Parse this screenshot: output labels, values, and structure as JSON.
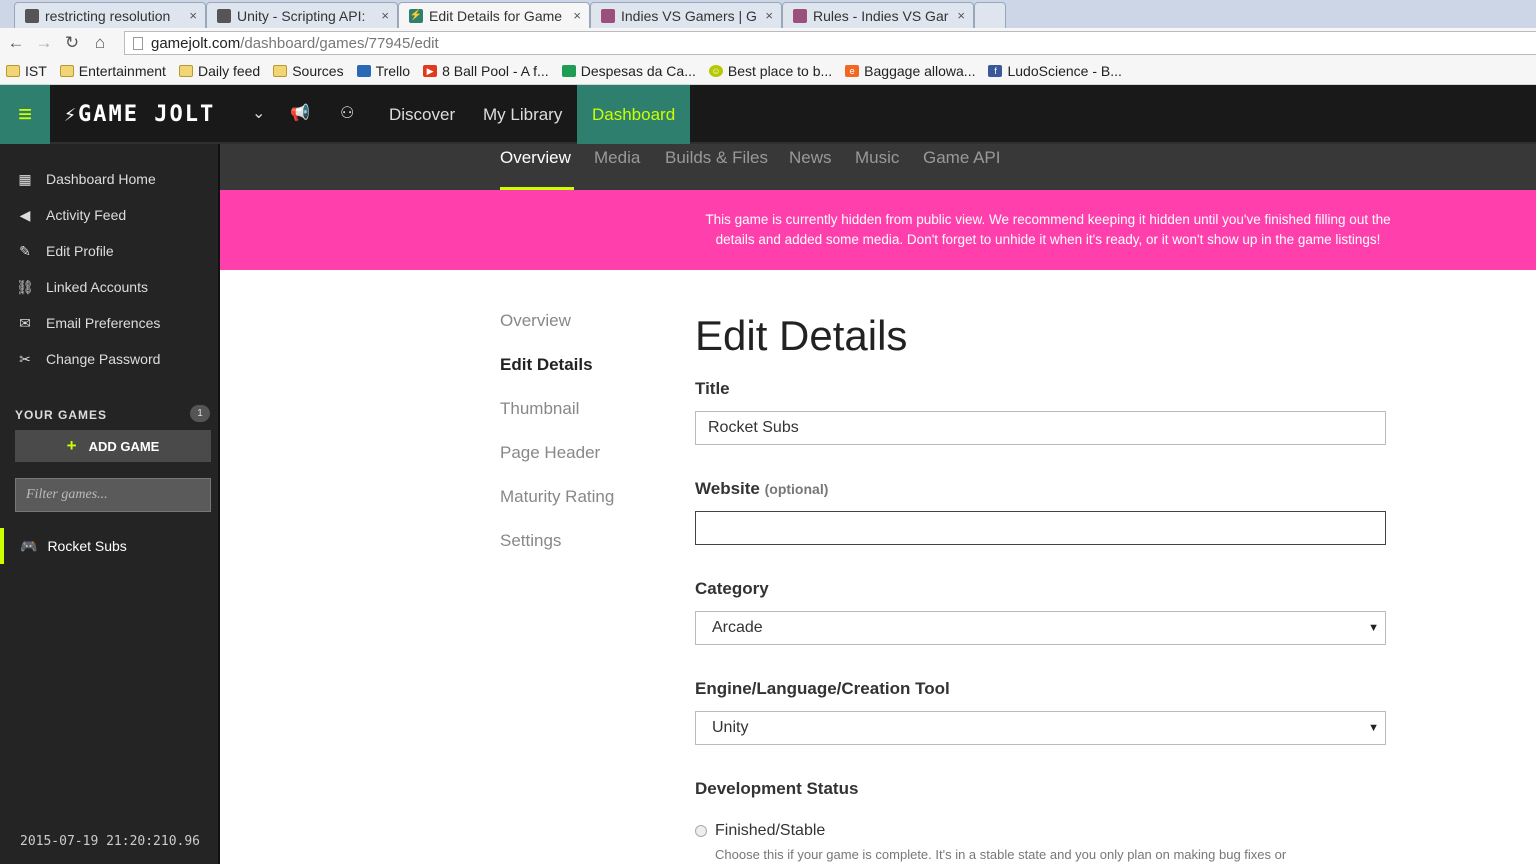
{
  "browser": {
    "tabs": [
      {
        "label": "restricting resolution",
        "favicon_color": "#555555",
        "active": false
      },
      {
        "label": "Unity - Scripting API:",
        "favicon_color": "#555555",
        "active": false
      },
      {
        "label": "Edit Details for Game",
        "favicon_color": "#2f7f6f",
        "active": true
      },
      {
        "label": "Indies VS Gamers | G",
        "favicon_color": "#9b4f7a",
        "active": false
      },
      {
        "label": "Rules - Indies VS Gar",
        "favicon_color": "#9b4f7a",
        "active": false
      }
    ],
    "close_glyph": "×",
    "url_host": "gamejolt.com",
    "url_path": "/dashboard/games/77945/edit",
    "nav_glyphs": {
      "back": "←",
      "forward": "→",
      "reload": "↻",
      "home": "⌂"
    },
    "bookmarks": [
      {
        "label": "IST",
        "icon": "folder-icon",
        "color": "#f2d675"
      },
      {
        "label": "Entertainment",
        "icon": "folder-icon",
        "color": "#f2d675"
      },
      {
        "label": "Daily feed",
        "icon": "folder-icon",
        "color": "#f2d675"
      },
      {
        "label": "Sources",
        "icon": "folder-icon",
        "color": "#f2d675"
      },
      {
        "label": "Trello",
        "icon": "trello-icon",
        "color": "#2a6ab5"
      },
      {
        "label": "8 Ball Pool - A f...",
        "icon": "play-icon",
        "color": "#e03a1e"
      },
      {
        "label": "Despesas da Ca...",
        "icon": "sheet-icon",
        "color": "#1f9d55"
      },
      {
        "label": "Best place to b...",
        "icon": "smiley-icon",
        "color": "#b5c800"
      },
      {
        "label": "Baggage allowa...",
        "icon": "e-icon",
        "color": "#f26722"
      },
      {
        "label": "LudoScience - B...",
        "icon": "facebook-icon",
        "color": "#3b5998"
      }
    ]
  },
  "header": {
    "logo_text": "GAME JOLT",
    "nav": [
      {
        "label": "Discover",
        "active": false
      },
      {
        "label": "My Library",
        "active": false
      },
      {
        "label": "Dashboard",
        "active": true
      }
    ],
    "colors": {
      "accent": "#ccff00",
      "teal": "#2f7f6f"
    }
  },
  "sidebar": {
    "items": [
      {
        "label": "Dashboard Home",
        "icon": "dashboard-icon",
        "glyph": "▦"
      },
      {
        "label": "Activity Feed",
        "icon": "megaphone-icon",
        "glyph": "📢"
      },
      {
        "label": "Edit Profile",
        "icon": "pencil-icon",
        "glyph": "✎"
      },
      {
        "label": "Linked Accounts",
        "icon": "link-icon",
        "glyph": "🔗"
      },
      {
        "label": "Email Preferences",
        "icon": "envelope-icon",
        "glyph": "✉"
      },
      {
        "label": "Change Password",
        "icon": "tools-icon",
        "glyph": "✂"
      }
    ],
    "your_games_label": "YOUR GAMES",
    "games_count": "1",
    "add_game_label": "ADD GAME",
    "filter_placeholder": "Filter games...",
    "games": [
      {
        "label": "Rocket Subs",
        "icon": "gamepad-icon"
      }
    ],
    "timestamp": "2015-07-19 21:20:210.96"
  },
  "subnav": {
    "tabs": [
      {
        "label": "Overview",
        "active": true
      },
      {
        "label": "Media",
        "active": false
      },
      {
        "label": "Builds & Files",
        "active": false
      },
      {
        "label": "News",
        "active": false
      },
      {
        "label": "Music",
        "active": false
      },
      {
        "label": "Game API",
        "active": false
      }
    ]
  },
  "banner": {
    "text": "This game is currently hidden from public view. We recommend keeping it hidden until you've finished filling out the details and added some media. Don't forget to unhide it when it's ready, or it won't show up in the game listings!",
    "color": "#ff3fac"
  },
  "left_nav": [
    {
      "label": "Overview",
      "active": false
    },
    {
      "label": "Edit Details",
      "active": true
    },
    {
      "label": "Thumbnail",
      "active": false
    },
    {
      "label": "Page Header",
      "active": false
    },
    {
      "label": "Maturity Rating",
      "active": false
    },
    {
      "label": "Settings",
      "active": false
    }
  ],
  "form": {
    "heading": "Edit Details",
    "title_label": "Title",
    "title_value": "Rocket Subs",
    "website_label": "Website",
    "website_optional": "(optional)",
    "website_value": "",
    "category_label": "Category",
    "category_value": "Arcade",
    "engine_label": "Engine/Language/Creation Tool",
    "engine_value": "Unity",
    "dev_status_label": "Development Status",
    "dev_status_option": "Finished/Stable",
    "dev_status_help": "Choose this if your game is complete. It's in a stable state and you only plan on making bug fixes or"
  }
}
